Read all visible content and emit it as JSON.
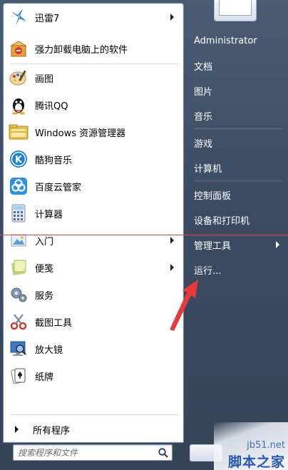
{
  "programs": [
    {
      "name": "xunlei-item",
      "icon": "xunlei-bird-icon",
      "label": "迅雷7",
      "has_submenu": true
    },
    {
      "name": "uninstall-item",
      "icon": "uninstall-package-icon",
      "label": "强力卸载电脑上的软件",
      "has_submenu": false
    },
    {
      "name": "paint-item",
      "icon": "paint-palette-icon",
      "label": "画图",
      "has_submenu": false
    },
    {
      "name": "qq-item",
      "icon": "qq-penguin-icon",
      "label": "腾讯QQ",
      "has_submenu": false
    },
    {
      "name": "explorer-item",
      "icon": "folder-explorer-icon",
      "label": "Windows 资源管理器",
      "has_submenu": false
    },
    {
      "name": "kugou-item",
      "icon": "kugou-music-icon",
      "label": "酷狗音乐",
      "has_submenu": false
    },
    {
      "name": "baidu-guard-item",
      "icon": "baidu-cloud-guard-icon",
      "label": "百度云管家",
      "has_submenu": false
    },
    {
      "name": "calculator-item",
      "icon": "calculator-icon",
      "label": "计算器",
      "has_submenu": false
    },
    {
      "name": "getting-started-item",
      "icon": "getting-started-icon",
      "label": "入门",
      "has_submenu": true
    },
    {
      "name": "sticky-notes-item",
      "icon": "sticky-notes-icon",
      "label": "便笺",
      "has_submenu": true
    },
    {
      "name": "services-item",
      "icon": "services-gear-icon",
      "label": "服务",
      "has_submenu": false
    },
    {
      "name": "snipping-tool-item",
      "icon": "snipping-scissors-icon",
      "label": "截图工具",
      "has_submenu": false
    },
    {
      "name": "magnifier-item",
      "icon": "magnifier-icon",
      "label": "放大镜",
      "has_submenu": false
    },
    {
      "name": "solitaire-item",
      "icon": "playing-cards-icon",
      "label": "纸牌",
      "has_submenu": false
    }
  ],
  "all_programs_label": "所有程序",
  "search": {
    "placeholder": "搜索程序和文件"
  },
  "right_items": [
    {
      "name": "administrator",
      "label": "Administrator",
      "has_submenu": false
    },
    {
      "name": "documents",
      "label": "文档",
      "has_submenu": false
    },
    {
      "name": "pictures",
      "label": "图片",
      "has_submenu": false
    },
    {
      "name": "music",
      "label": "音乐",
      "has_submenu": false
    },
    {
      "name": "games",
      "label": "游戏",
      "has_submenu": false
    },
    {
      "name": "computer",
      "label": "计算机",
      "has_submenu": false
    },
    {
      "name": "control-panel",
      "label": "控制面板",
      "has_submenu": false
    },
    {
      "name": "devices-printers",
      "label": "设备和打印机",
      "has_submenu": false
    },
    {
      "name": "admin-tools",
      "label": "管理工具",
      "has_submenu": true
    },
    {
      "name": "run",
      "label": "运行...",
      "has_submenu": false
    }
  ],
  "watermark": {
    "site": "jb51.net",
    "name": "脚本之家"
  },
  "colors": {
    "annotation_red": "#e34848",
    "menu_right_bg": "#3f4f66"
  }
}
